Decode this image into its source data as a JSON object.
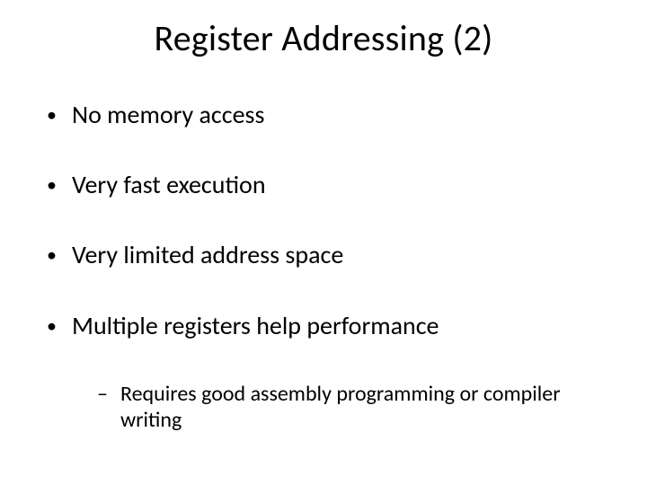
{
  "title": "Register Addressing (2)",
  "bullets": [
    {
      "text": "No memory access"
    },
    {
      "text": "Very fast execution"
    },
    {
      "text": "Very limited address space"
    },
    {
      "text": "Multiple registers help performance",
      "sub": [
        "Requires good assembly programming or compiler writing"
      ]
    }
  ],
  "glyphs": {
    "bullet": "•",
    "dash": "–"
  }
}
